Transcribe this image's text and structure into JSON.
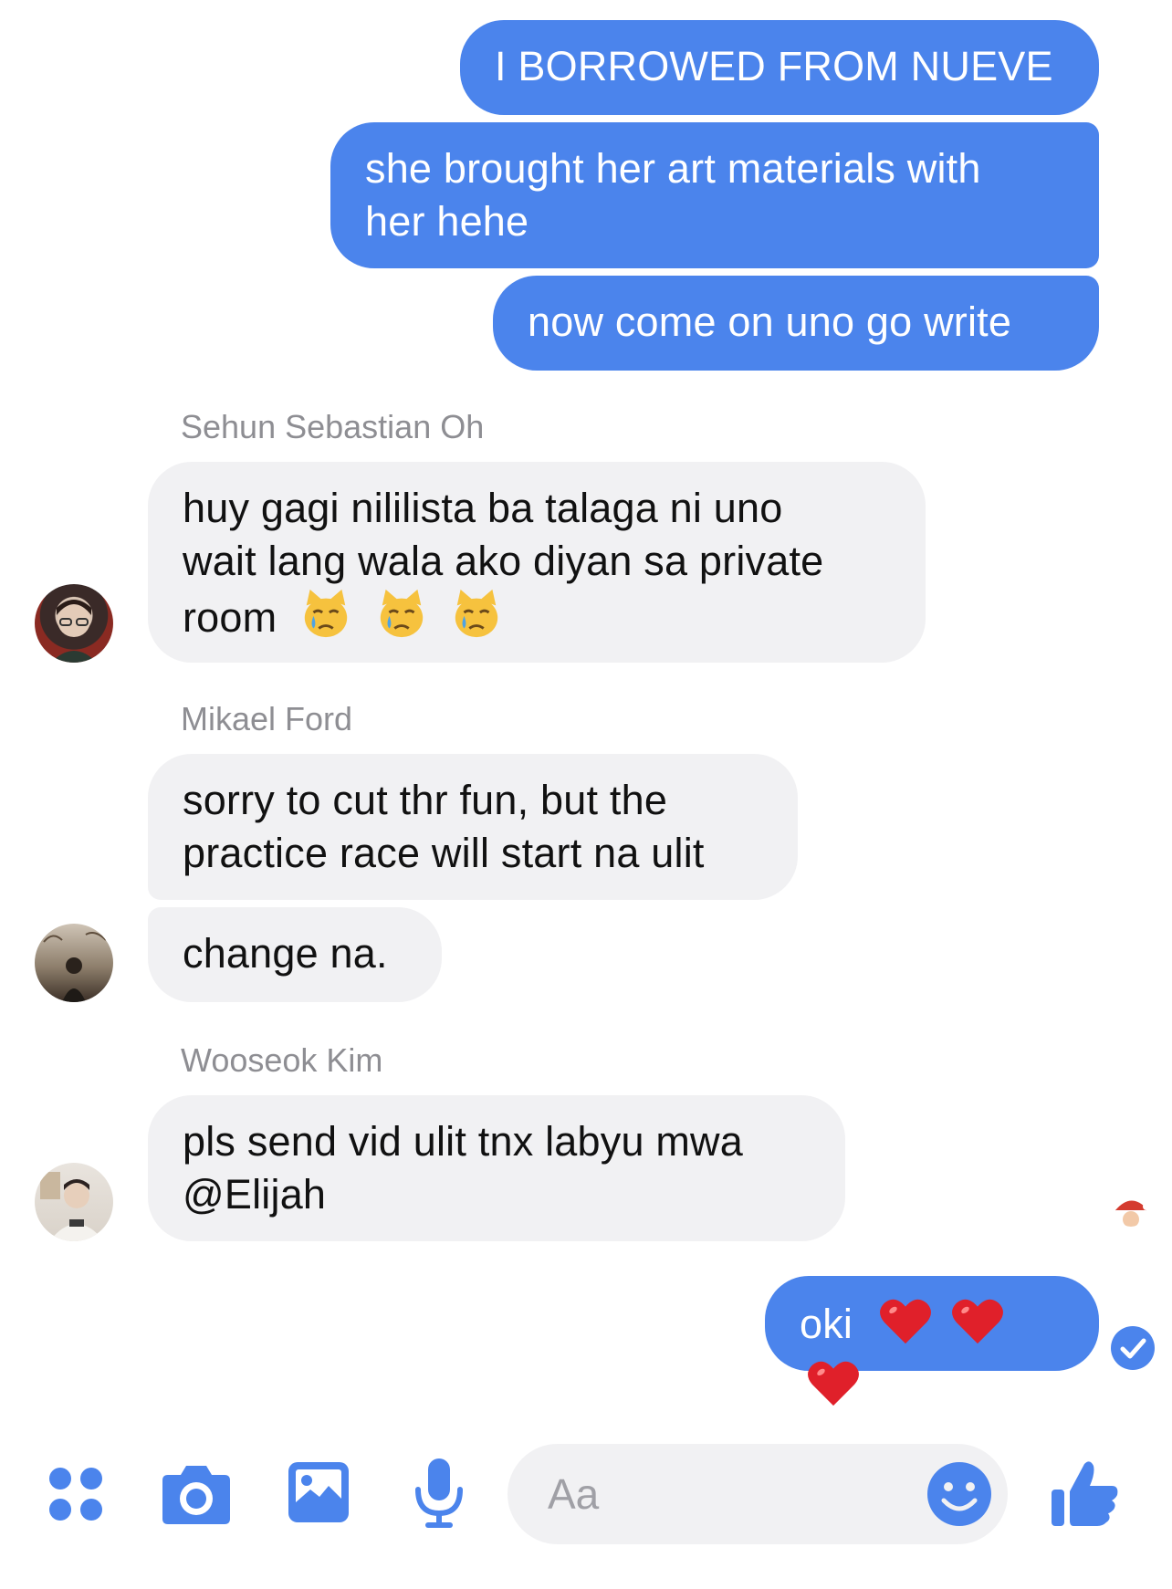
{
  "colors": {
    "accent": "#4b84ec",
    "incoming_bubble": "#f1f1f3",
    "sender_name": "#8e8e93"
  },
  "messages": [
    {
      "direction": "outgoing",
      "text": "I BORROWED FROM NUEVE"
    },
    {
      "direction": "outgoing",
      "text_lines": [
        "she brought her art materials with",
        "her hehe"
      ]
    },
    {
      "direction": "outgoing",
      "text": "now come on uno go write"
    },
    {
      "direction": "incoming",
      "sender": "Sehun Sebastian Oh",
      "text_lines": [
        "huy gagi nililista ba talaga ni uno",
        "wait lang wala ako diyan sa private",
        "room"
      ],
      "emoji": [
        "crying-cat-icon",
        "crying-cat-icon",
        "crying-cat-icon"
      ]
    },
    {
      "direction": "incoming",
      "sender": "Mikael Ford",
      "text_lines": [
        "sorry to cut thr fun, but the",
        "practice race will start na ulit"
      ]
    },
    {
      "direction": "incoming",
      "text": "change na."
    },
    {
      "direction": "incoming",
      "sender": "Wooseok Kim",
      "text_lines": [
        "pls send vid ulit tnx labyu mwa",
        "@Elijah"
      ]
    },
    {
      "direction": "outgoing",
      "text": "oki",
      "emoji": [
        "red-heart-icon",
        "red-heart-icon",
        "red-heart-icon"
      ],
      "status": "delivered-check-icon"
    }
  ],
  "read_receipt": "santa-avatar-icon",
  "toolbar": {
    "icons": [
      "apps-grid-icon",
      "camera-icon",
      "gallery-icon",
      "microphone-icon",
      "emoji-smile-icon",
      "thumbs-up-icon"
    ],
    "input_placeholder": "Aa"
  }
}
